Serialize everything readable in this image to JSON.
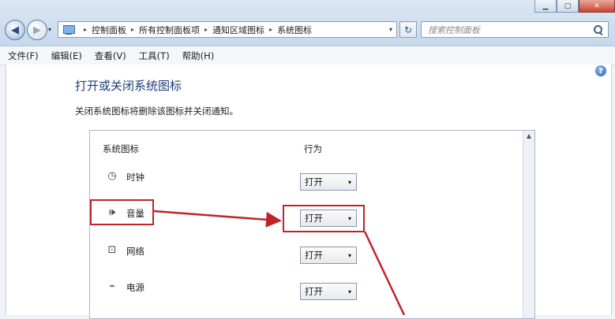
{
  "window": {
    "min_glyph": "▁",
    "max_glyph": "▢",
    "close_glyph": "✕"
  },
  "nav": {
    "back_glyph": "◀",
    "forward_glyph": "▶",
    "history_glyph": "▾",
    "refresh_glyph": "↻"
  },
  "breadcrumb": [
    "控制面板",
    "所有控制面板项",
    "通知区域图标",
    "系统图标"
  ],
  "breadcrumb_sep": "▸",
  "search": {
    "placeholder": "搜索控制面板"
  },
  "menu": [
    "文件(F)",
    "编辑(E)",
    "查看(V)",
    "工具(T)",
    "帮助(H)"
  ],
  "help_glyph": "?",
  "page": {
    "title": "打开或关闭系统图标",
    "description": "关闭系统图标将删除该图标并关闭通知。"
  },
  "table": {
    "col_icon": "系统图标",
    "col_behavior": "行为",
    "rows": [
      {
        "icon": "clock-icon",
        "glyph": "◷",
        "label": "时钟",
        "value": "打开"
      },
      {
        "icon": "volume-icon",
        "glyph": "🕪",
        "label": "音量",
        "value": "打开"
      },
      {
        "icon": "network-icon",
        "glyph": "⊡",
        "label": "网络",
        "value": "打开"
      },
      {
        "icon": "power-icon",
        "glyph": "⌁",
        "label": "电源",
        "value": "打开"
      }
    ]
  },
  "scroll_up_glyph": "▲",
  "colors": {
    "annotation_red": "#c0242a",
    "title_blue": "#1e3d7a"
  }
}
